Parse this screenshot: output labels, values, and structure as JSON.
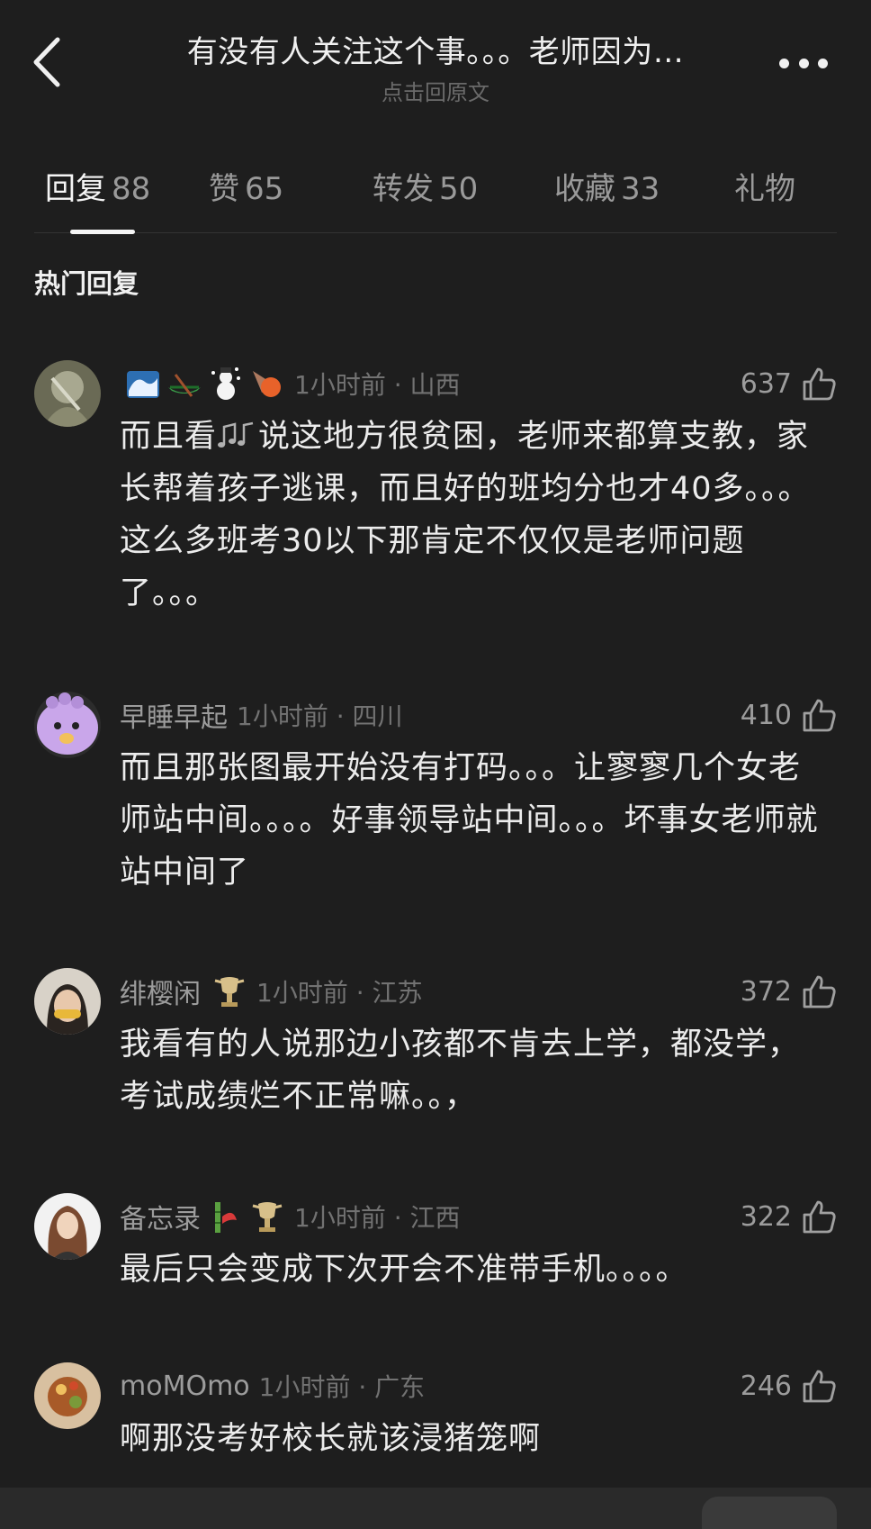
{
  "header": {
    "title": "有没有人关注这个事。。。老师因为…",
    "subtitle": "点击回原文"
  },
  "tabs": [
    {
      "label": "回复",
      "count": "88",
      "active": true
    },
    {
      "label": "赞",
      "count": "65",
      "active": false
    },
    {
      "label": "转发",
      "count": "50",
      "active": false
    },
    {
      "label": "收藏",
      "count": "33",
      "active": false
    },
    {
      "label": "礼物",
      "count": "",
      "active": false
    }
  ],
  "section_title": "热门回复",
  "comments": [
    {
      "username": "",
      "badges": [
        "wave-emoji",
        "canoe-emoji",
        "snowman-emoji",
        "comet-emoji"
      ],
      "time_location": "1小时前 · 山西",
      "likes": "637",
      "text_before": "而且看",
      "inline_emoji": "music-notes-emoji",
      "text_after": "说这地方很贫困，老师来都算支教，家长帮着孩子逃课，而且好的班均分也才40多。。。这么多班考30以下那肯定不仅仅是老师问题了。。。"
    },
    {
      "username": "早睡早起",
      "time_location": "1小时前 · 四川",
      "likes": "410",
      "text": "而且那张图最开始没有打码。。。让寥寥几个女老师站中间。。。。好事领导站中间。。。坏事女老师就站中间了"
    },
    {
      "username": "绯樱闲",
      "time_location": "1小时前 · 江苏",
      "likes": "372",
      "text": "我看有的人说那边小孩都不肯去上学，都没学，考试成绩烂不正常嘛。。，"
    },
    {
      "username": "备忘录",
      "time_location": "1小时前 · 江西",
      "likes": "322",
      "text": "最后只会变成下次开会不准带手机。。。。"
    },
    {
      "username": "moMOmo",
      "time_location": "1小时前 · 广东",
      "likes": "246",
      "text": "啊那没考好校长就该浸猪笼啊"
    }
  ]
}
